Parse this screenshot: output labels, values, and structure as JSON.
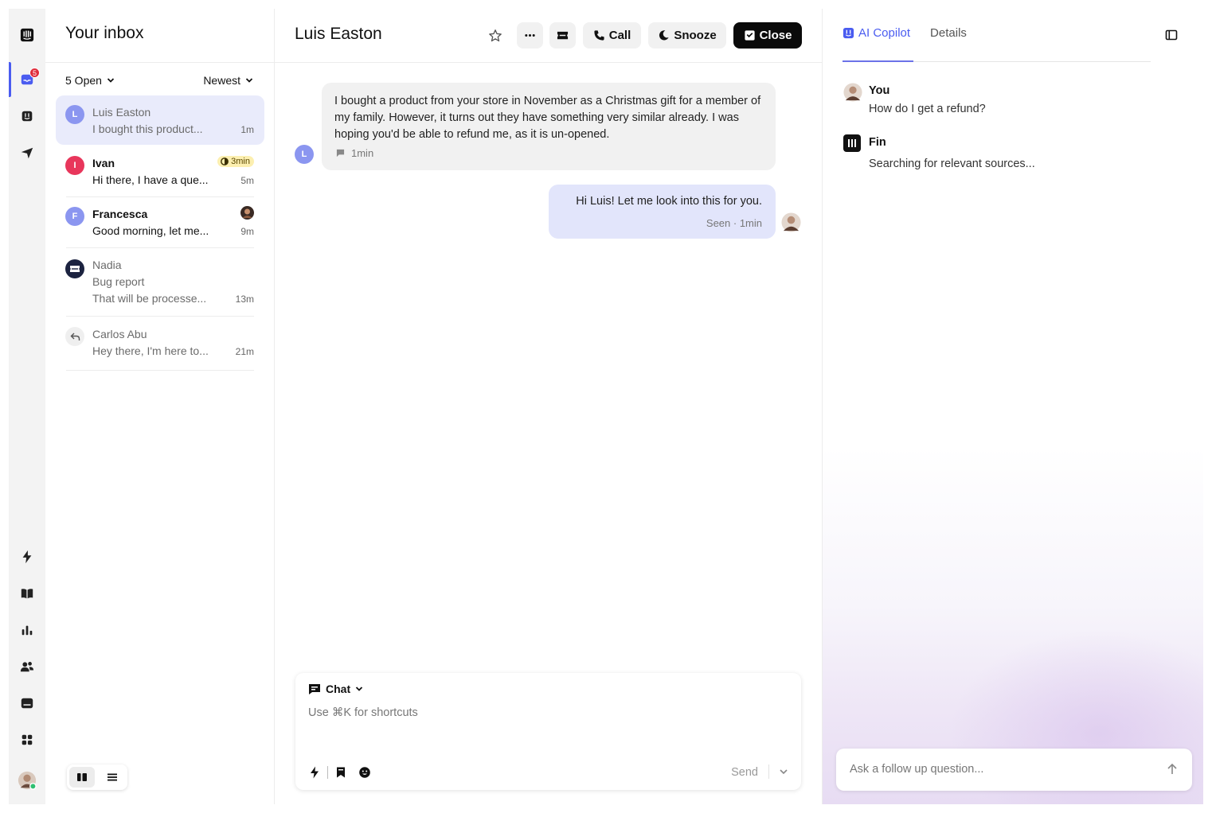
{
  "rail": {
    "inbox_badge": "5",
    "top_icons": [
      "intercom-logo-icon",
      "inbox-icon",
      "fin-icon",
      "outbound-icon"
    ],
    "bottom_icons": [
      "bolt-icon",
      "book-icon",
      "reports-icon",
      "contacts-icon",
      "messages-icon",
      "apps-icon"
    ]
  },
  "inbox": {
    "title": "Your inbox",
    "filter_open": "5 Open",
    "filter_sort": "Newest",
    "conversations": [
      {
        "initial": "L",
        "name": "Luis Easton",
        "preview": "I bought this product...",
        "time": "1m",
        "color": "#8b96f0"
      },
      {
        "initial": "I",
        "name": "Ivan",
        "preview": "Hi there, I have a que...",
        "time": "5m",
        "sla": "3min",
        "color": "#e8365b"
      },
      {
        "initial": "F",
        "name": "Francesca",
        "preview": "Good morning, let me...",
        "time": "9m",
        "color": "#8b96f0"
      },
      {
        "name": "Nadia",
        "subject": "Bug report",
        "preview": "That will be processe...",
        "time": "13m"
      },
      {
        "name": "Carlos Abu",
        "preview": "Hey there, I'm here to...",
        "time": "21m"
      }
    ]
  },
  "conversation": {
    "title": "Luis Easton",
    "buttons": {
      "call": "Call",
      "snooze": "Snooze",
      "close": "Close"
    },
    "messages": [
      {
        "author_initial": "L",
        "text": "I bought a product from your store in November as a Christmas gift for a member of my family. However, it turns out they have something very similar already. I was hoping you'd be able to refund me, as it is un-opened.",
        "time": "1min"
      },
      {
        "text": "Hi Luis! Let me look into this for you.",
        "status": "Seen · 1min"
      }
    ],
    "composer": {
      "type": "Chat",
      "placeholder": "Use ⌘K for shortcuts",
      "send": "Send"
    }
  },
  "copilot": {
    "tab_ai": "AI Copilot",
    "tab_details": "Details",
    "you_label": "You",
    "you_question": "How do I get a refund?",
    "fin_label": "Fin",
    "fin_status": "Searching for relevant sources...",
    "input_placeholder": "Ask a follow up question..."
  },
  "colors": {
    "accent": "#4a5cf0",
    "active_row": "#e9ebfb",
    "outgoing_bubble": "#e2e5fb",
    "badge": "#e02d3c"
  }
}
